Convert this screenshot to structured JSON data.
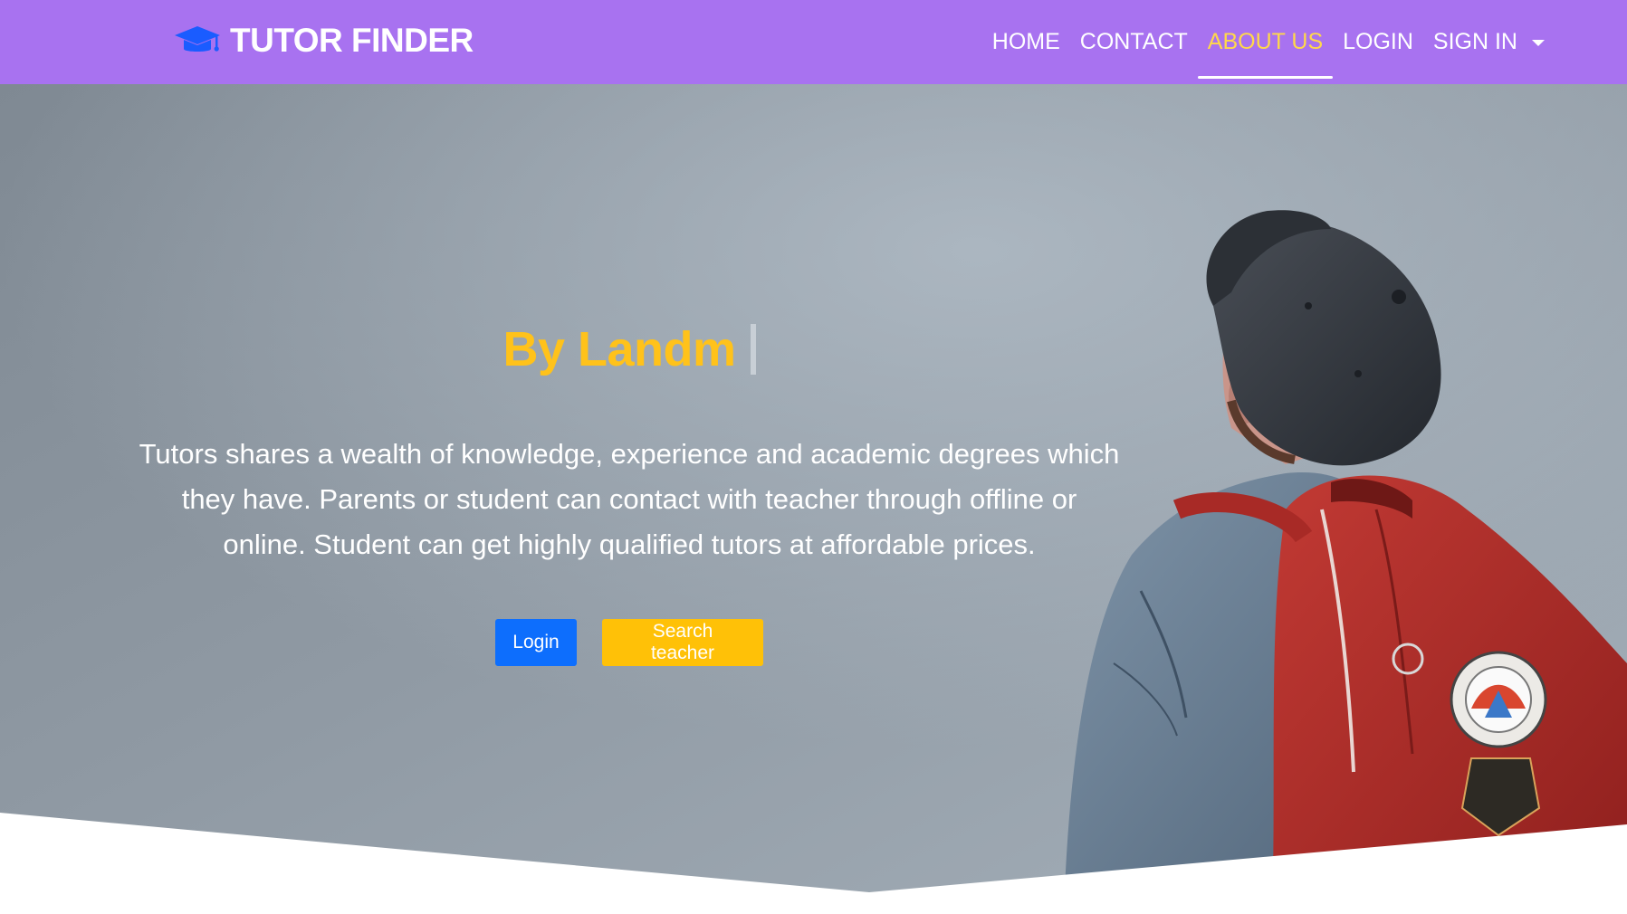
{
  "navbar": {
    "brand": "TUTOR FINDER",
    "brand_icon": "graduation-cap-icon",
    "items": [
      {
        "label": "HOME",
        "active": false
      },
      {
        "label": "CONTACT",
        "active": false
      },
      {
        "label": "ABOUT US",
        "active": true
      },
      {
        "label": "LOGIN",
        "active": false
      },
      {
        "label": "SIGN IN",
        "active": false,
        "dropdown": true
      }
    ],
    "background_color": "#a872f0",
    "active_color": "#ffd84a"
  },
  "hero": {
    "title": "By Landm",
    "description_lines": [
      "Tutors shares a wealth of knowledge, experience and academic degrees which",
      "they have. Parents or student can contact with teacher through offline or",
      "online. Student can get highly qualified tutors at affordable prices."
    ],
    "buttons": {
      "login": "Login",
      "search_teacher": "Search teacher"
    },
    "title_color": "#ffc21a",
    "login_button_color": "#0d6efd",
    "search_button_color": "#ffc107"
  }
}
